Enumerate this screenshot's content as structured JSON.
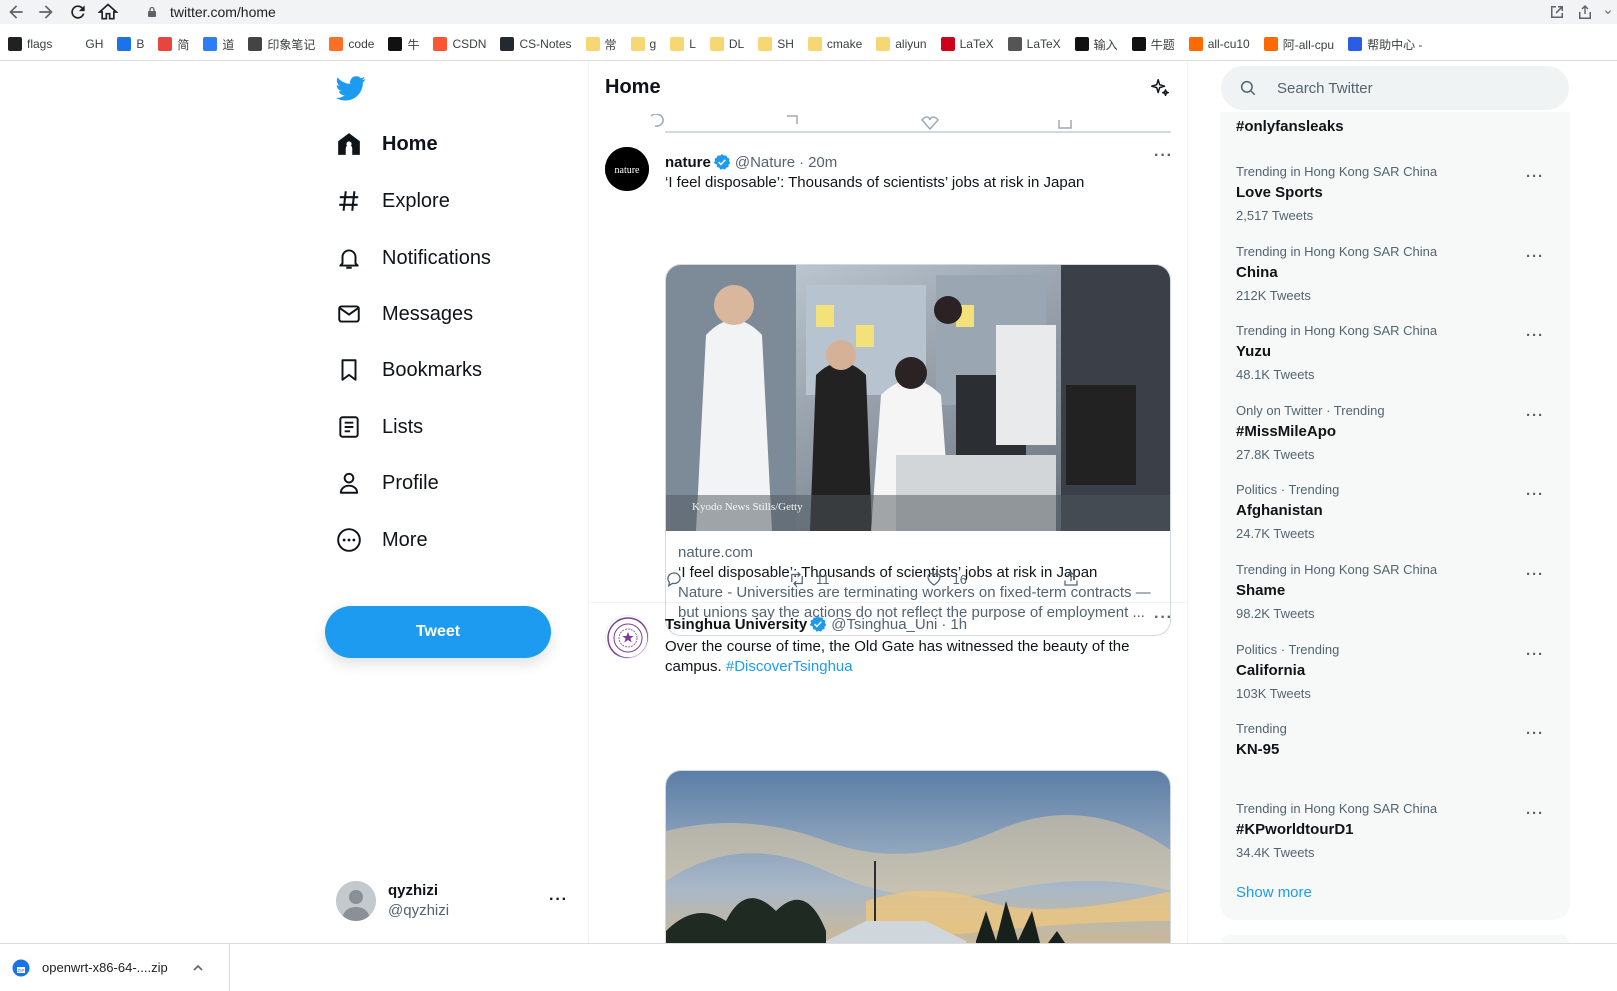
{
  "browser": {
    "url": "twitter.com/home",
    "bookmarks": [
      {
        "label": "flags",
        "color": "#202124"
      },
      {
        "label": "GH",
        "color": "#ffffff"
      },
      {
        "label": "B",
        "color": "#1a73e8"
      },
      {
        "label": "简",
        "color": "#e8453c"
      },
      {
        "label": "道",
        "color": "#2f7cf6"
      },
      {
        "label": "印象笔记",
        "color": "#444"
      },
      {
        "label": "code",
        "color": "#fc6d26"
      },
      {
        "label": "牛",
        "color": "#111"
      },
      {
        "label": "CSDN",
        "color": "#fc5531"
      },
      {
        "label": "CS-Notes",
        "color": "#24292f"
      },
      {
        "label": "常",
        "color": "#f7d774"
      },
      {
        "label": "g",
        "color": "#f7d774"
      },
      {
        "label": "L",
        "color": "#f7d774"
      },
      {
        "label": "DL",
        "color": "#f7d774"
      },
      {
        "label": "SH",
        "color": "#f7d774"
      },
      {
        "label": "cmake",
        "color": "#f7d774"
      },
      {
        "label": "aliyun",
        "color": "#f7d774"
      },
      {
        "label": "LaTeX",
        "color": "#d0021b"
      },
      {
        "label": "LaTeX",
        "color": "#555"
      },
      {
        "label": "输入",
        "color": "#111"
      },
      {
        "label": "牛题",
        "color": "#111"
      },
      {
        "label": "all-cu10",
        "color": "#ff6a00"
      },
      {
        "label": "阿-all-cpu",
        "color": "#ff6a00"
      },
      {
        "label": "帮助中心 -",
        "color": "#2b5ce6"
      }
    ]
  },
  "nav": {
    "items": [
      {
        "label": "Home",
        "icon": "home-icon"
      },
      {
        "label": "Explore",
        "icon": "hashtag-icon"
      },
      {
        "label": "Notifications",
        "icon": "bell-icon"
      },
      {
        "label": "Messages",
        "icon": "envelope-icon"
      },
      {
        "label": "Bookmarks",
        "icon": "bookmark-icon"
      },
      {
        "label": "Lists",
        "icon": "list-icon"
      },
      {
        "label": "Profile",
        "icon": "person-icon"
      },
      {
        "label": "More",
        "icon": "more-circle-icon"
      }
    ],
    "tweet_button": "Tweet",
    "account": {
      "display_name": "qyzhizi",
      "handle": "@qyzhizi",
      "more": "···"
    }
  },
  "main": {
    "title": "Home",
    "tweets": [
      {
        "name": "nature",
        "handle": "@Nature",
        "sep": "·",
        "time": "20m",
        "text": "‘I feel disposable’: Thousands of scientists’ jobs at risk in Japan",
        "card": {
          "image_credit": "Kyodo News Stills/Getty",
          "domain": "nature.com",
          "title": "‘I feel disposable’: Thousands of scientists’ jobs at risk in Japan",
          "description": "Nature - Universities are terminating workers on fixed-term contracts — but unions say the actions do not reflect the purpose of employment ..."
        },
        "actions": {
          "reply": "",
          "retweet": "11",
          "like": "16"
        }
      },
      {
        "name": "Tsinghua University",
        "handle": "@Tsinghua_Uni",
        "sep": "·",
        "time": "1h",
        "text": "Over the course of time, the Old Gate has witnessed the beauty of the campus.",
        "hashtag": "#DiscoverTsinghua"
      }
    ],
    "avatar_label": "nature"
  },
  "search": {
    "placeholder": "Search Twitter"
  },
  "trends": {
    "top_partial": "#onlyfansleaks",
    "items": [
      {
        "context": "Trending in Hong Kong SAR China",
        "name": "Love Sports",
        "count": "2,517 Tweets"
      },
      {
        "context": "Trending in Hong Kong SAR China",
        "name": "China",
        "count": "212K Tweets"
      },
      {
        "context": "Trending in Hong Kong SAR China",
        "name": "Yuzu",
        "count": "48.1K Tweets"
      },
      {
        "context": "Only on Twitter · Trending",
        "name": "#MissMileApo",
        "count": "27.8K Tweets"
      },
      {
        "context": "Politics · Trending",
        "name": "Afghanistan",
        "count": "24.7K Tweets"
      },
      {
        "context": "Trending in Hong Kong SAR China",
        "name": "Shame",
        "count": "98.2K Tweets"
      },
      {
        "context": "Politics · Trending",
        "name": "California",
        "count": "103K Tweets"
      },
      {
        "context": "Trending",
        "name": "KN-95",
        "count": ""
      },
      {
        "context": "Trending in Hong Kong SAR China",
        "name": "#KPworldtourD1",
        "count": "34.4K Tweets"
      }
    ],
    "more_dots": "···",
    "show_more": "Show more"
  },
  "download": {
    "filename": "openwrt-x86-64-....zip"
  },
  "colors": {
    "accent": "#1d9bf0",
    "text": "#0f1419",
    "secondary": "#536471"
  }
}
